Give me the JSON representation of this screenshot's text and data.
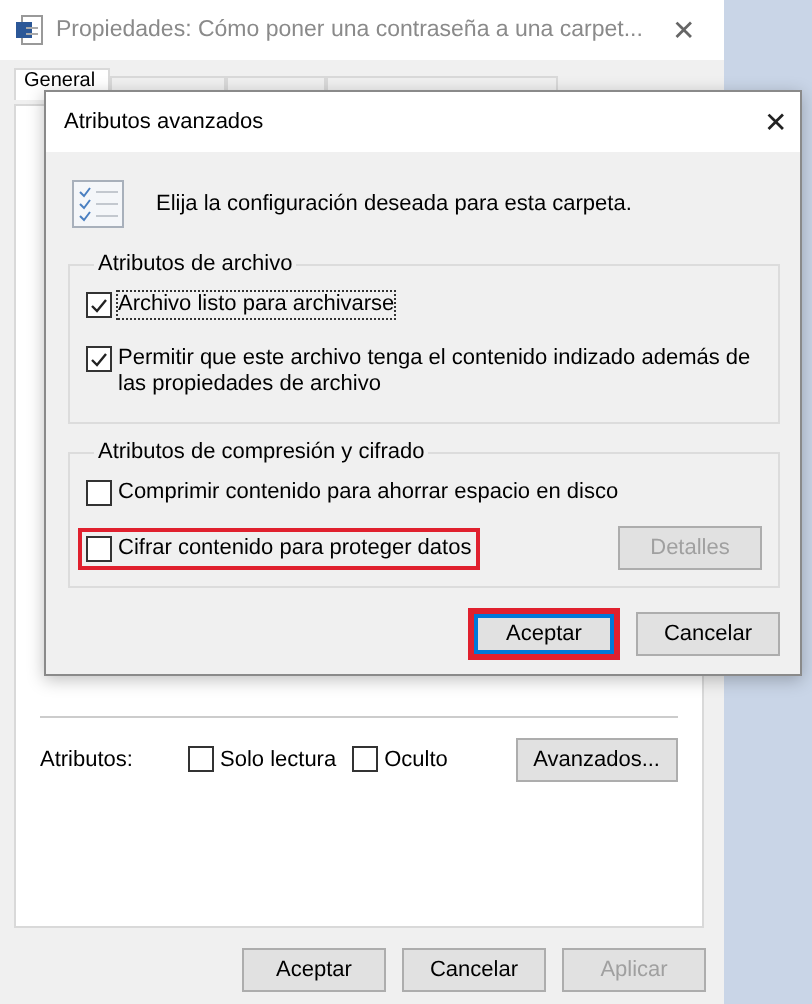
{
  "window": {
    "title": "Propiedades: Cómo poner una contraseña a una carpet...",
    "close": "✕"
  },
  "tabs": [
    {
      "label": "General",
      "selected": true
    },
    {
      "selected": false
    },
    {
      "selected": false
    },
    {
      "selected": false
    }
  ],
  "attributes": {
    "label": "Atributos:",
    "options": [
      {
        "label": "Solo lectura",
        "checked": false
      },
      {
        "label": "Oculto",
        "checked": false
      }
    ],
    "button": "Avanzados..."
  },
  "buttons": [
    {
      "label": "Aceptar",
      "disabled": false
    },
    {
      "label": "Cancelar",
      "disabled": false
    },
    {
      "label": "Aplicar",
      "disabled": true
    }
  ],
  "dialog": {
    "title": "Atributos avanzados",
    "close": "✕",
    "intro": "Elija la configuración deseada para esta carpeta.",
    "groups": [
      {
        "title": "Atributos de archivo",
        "options": [
          {
            "label": "Archivo listo para archivarse",
            "checked": true,
            "focused": true,
            "highlighted": false
          },
          {
            "label": "Permitir que este archivo tenga el contenido indizado además de las propiedades de archivo",
            "checked": true,
            "focused": false,
            "highlighted": false
          }
        ]
      },
      {
        "title": "Atributos de compresión y cifrado",
        "options": [
          {
            "label": "Comprimir contenido para ahorrar espacio en disco",
            "checked": false,
            "focused": false,
            "highlighted": false
          },
          {
            "label": "Cifrar contenido para proteger datos",
            "checked": false,
            "focused": false,
            "highlighted": true
          }
        ],
        "button": {
          "label": "Detalles",
          "disabled": true
        }
      }
    ],
    "buttons": [
      {
        "label": "Aceptar",
        "default": true,
        "highlighted": true
      },
      {
        "label": "Cancelar",
        "default": false,
        "highlighted": false
      }
    ]
  }
}
